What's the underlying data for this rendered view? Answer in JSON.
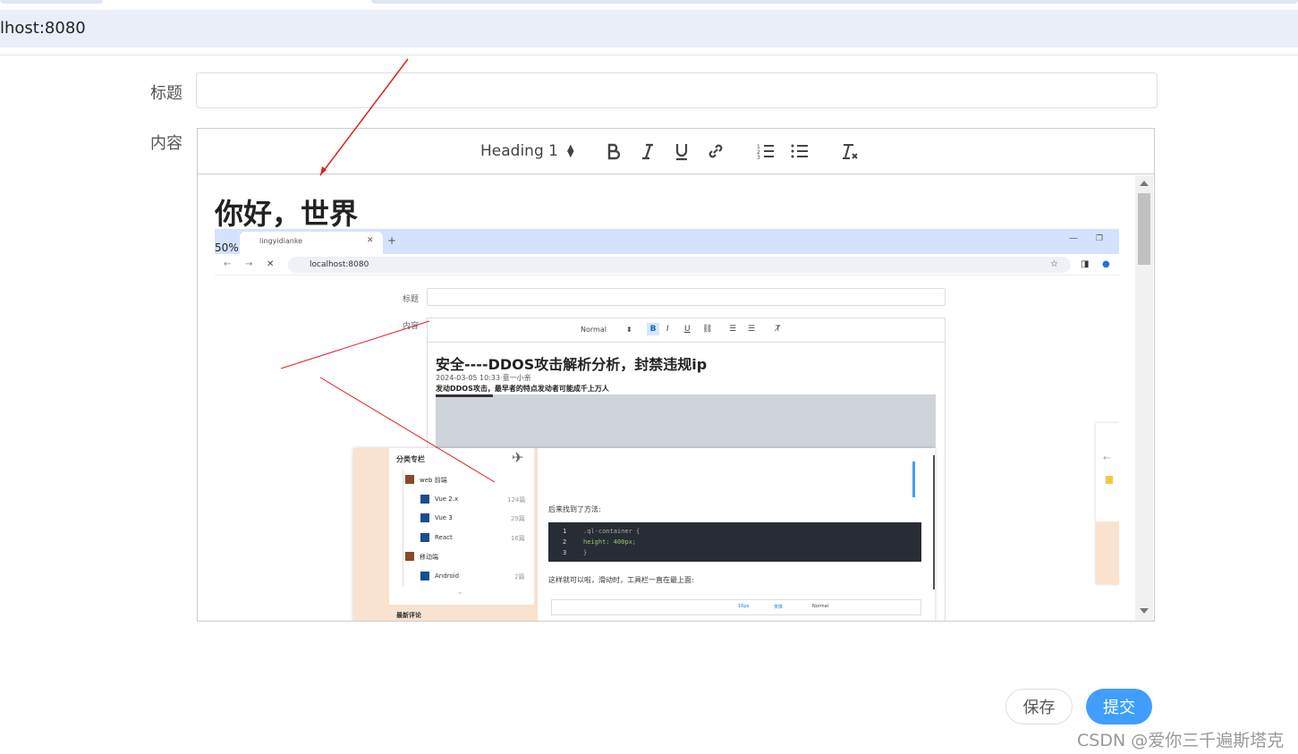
{
  "browser": {
    "url": "lhost:8080"
  },
  "form": {
    "title_label": "标题",
    "content_label": "内容",
    "title_value": ""
  },
  "toolbar": {
    "heading_value": "Heading 1",
    "icons": [
      "bold-icon",
      "italic-icon",
      "underline-icon",
      "link-icon",
      "ordered-list-icon",
      "bullet-list-icon",
      "clear-format-icon"
    ]
  },
  "editor": {
    "heading": "你好，世界",
    "embedded_screenshot": {
      "zoom": "50%",
      "tab_title": "lingyidianke",
      "new_tab": "+",
      "url": "localhost:8080",
      "title_label": "标题",
      "content_label": "内容",
      "toolbar_select": "Normal",
      "article_title": "安全----DDOS攻击解析分析，封禁违规ip",
      "article_meta": "2024-03-05 10:33·意一小亲",
      "article_line": "发动DDOS攻击，最早者的特点发动者可能成千上万人",
      "sidebar_title": "分类专栏",
      "sidebar_items": [
        {
          "label": "web 前端",
          "count": ""
        },
        {
          "label": "Vue 2.x",
          "count": "124篇"
        },
        {
          "label": "Vue 3",
          "count": "29篇"
        },
        {
          "label": "React",
          "count": "16篇"
        },
        {
          "label": "移动端",
          "count": ""
        },
        {
          "label": "Android",
          "count": "2篇"
        }
      ],
      "sidebar_next": "最新评论",
      "found_text": "后来找到了方法:",
      "code_lines": [
        {
          "num": "1",
          "code": ".ql-container {"
        },
        {
          "num": "2",
          "code": "  height: 400px;"
        },
        {
          "num": "3",
          "code": "}"
        }
      ],
      "after_text": "这样就可以啦，滑动时，工具栏一直在最上面:",
      "mini_toolbar_size": "10px",
      "mini_toolbar_font": "宋体",
      "mini_toolbar_normal": "Normal"
    }
  },
  "actions": {
    "save_label": "保存",
    "submit_label": "提交"
  },
  "watermark": "CSDN @爱你三千遍斯塔克",
  "colors": {
    "primary": "#409eff",
    "browser_bar": "#e9eef8",
    "annotation_arrow": "#e02020"
  }
}
